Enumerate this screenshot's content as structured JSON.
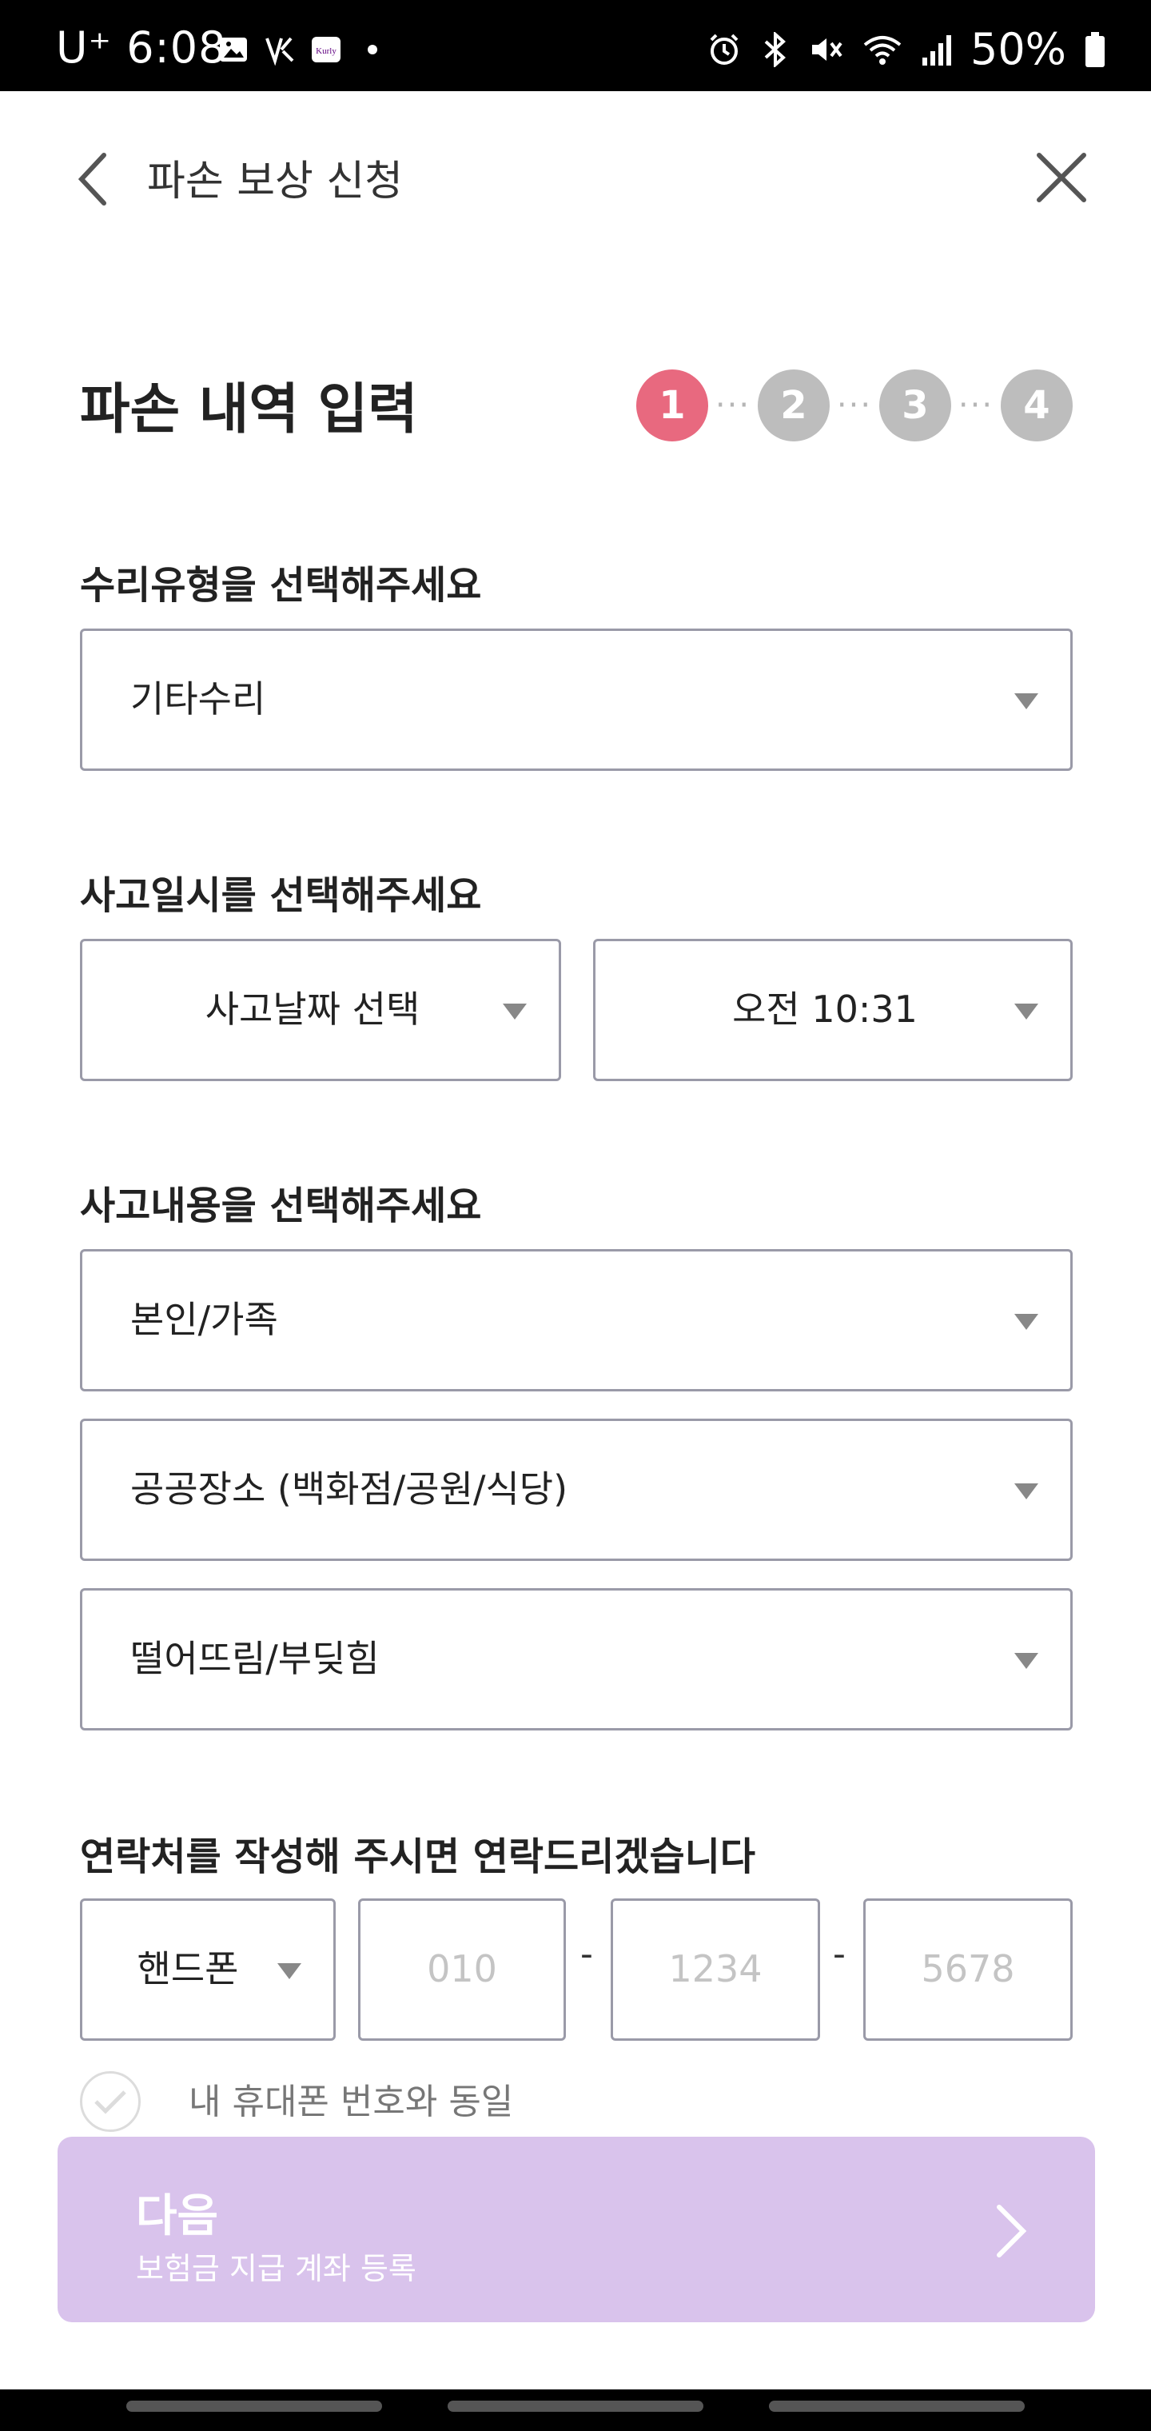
{
  "status_bar": {
    "carrier": "U⁺",
    "time": "6:08",
    "battery": "50%"
  },
  "header": {
    "title": "파손 보상 신청"
  },
  "page": {
    "title": "파손 내역 입력",
    "steps": [
      "1",
      "2",
      "3",
      "4"
    ],
    "active_step": "1"
  },
  "repair_type": {
    "label": "수리유형을 선택해주세요",
    "value": "기타수리"
  },
  "accident_datetime": {
    "label": "사고일시를 선택해주세요",
    "date_value": "사고날짜 선택",
    "time_value": "오전 10:31"
  },
  "accident_details": {
    "label": "사고내용을 선택해주세요",
    "who": "본인/가족",
    "place": "공공장소 (백화점/공원/식당)",
    "cause": "떨어뜨림/부딪힘"
  },
  "contact": {
    "label": "연락처를 작성해 주시면 연락드리겠습니다",
    "phone_type": "핸드폰",
    "part1_placeholder": "010",
    "part2_placeholder": "1234",
    "part3_placeholder": "5678",
    "separator": "-",
    "same_as_mine_label": "내 휴대폰 번호와 동일"
  },
  "next_button": {
    "title": "다음",
    "subtitle": "보험금 지급 계좌 등록"
  },
  "colors": {
    "active_step": "#e8697f",
    "inactive_step": "#bdbdbd",
    "next_button_bg": "#d9c3ec"
  }
}
